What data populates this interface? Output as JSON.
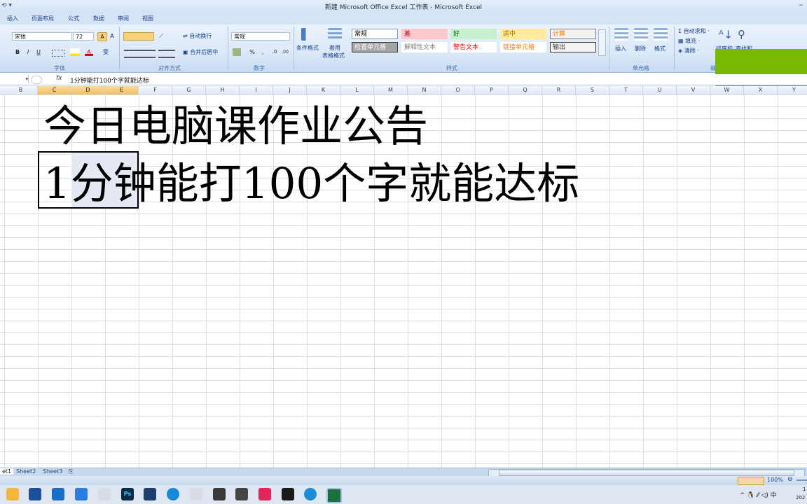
{
  "window": {
    "title": "新建 Microsoft Office Excel 工作表 - Microsoft Excel",
    "quick_access": "⟲ ▾",
    "minimize": "–"
  },
  "tabs": [
    "插入",
    "页面布局",
    "公式",
    "数据",
    "审阅",
    "视图"
  ],
  "ribbon": {
    "font": {
      "name": "宋体",
      "size": "72",
      "group_label": "字体",
      "bold": "B",
      "italic": "I",
      "underline": "U",
      "grow": "A",
      "shrink": "A",
      "font_color": "A",
      "phonetic": "雯"
    },
    "alignment": {
      "wrap_text": "自动换行",
      "merge_center": "合并后居中",
      "group_label": "对齐方式"
    },
    "number": {
      "format": "常规",
      "group_label": "数字",
      "percent": "%",
      "comma": ",",
      "inc_dec": ".0",
      "dec_dec": ".00"
    },
    "styles": {
      "conditional": "条件格式",
      "table_format_1": "套用",
      "table_format_2": "表格格式",
      "cells": [
        {
          "label": "常规",
          "bg": "#ffffff",
          "color": "#000000",
          "border": "#7f9db9"
        },
        {
          "label": "差",
          "bg": "#ffc7ce",
          "color": "#9c0006",
          "border": "#ffc7ce"
        },
        {
          "label": "好",
          "bg": "#c6efce",
          "color": "#006100",
          "border": "#c6efce"
        },
        {
          "label": "适中",
          "bg": "#ffeb9c",
          "color": "#9c6500",
          "border": "#ffeb9c"
        },
        {
          "label": "计算",
          "bg": "#f2f2f2",
          "color": "#fa7d00",
          "border": "#7f7f7f"
        },
        {
          "label": "检查单元格",
          "bg": "#a5a5a5",
          "color": "#ffffff",
          "border": "#3f3f3f"
        },
        {
          "label": "解释性文本",
          "bg": "#ffffff",
          "color": "#7f7f7f",
          "border": "#ffffff"
        },
        {
          "label": "警告文本",
          "bg": "#ffffff",
          "color": "#ff0000",
          "border": "#ffffff"
        },
        {
          "label": "链接单元格",
          "bg": "#ffffff",
          "color": "#fa7d00",
          "border": "#ffffff"
        },
        {
          "label": "输出",
          "bg": "#f2f2f2",
          "color": "#3f3f3f",
          "border": "#3f3f3f"
        }
      ],
      "group_label": "样式"
    },
    "cells_group": {
      "insert": "插入",
      "delete": "删除",
      "format": "格式",
      "group_label": "单元格"
    },
    "editing": {
      "autosum": "Σ 自动求和 ·",
      "fill": "填充 ·",
      "clear": "清除 ·",
      "sort": "排序和",
      "find": "查找和",
      "group_label": "编"
    }
  },
  "formula_bar": {
    "fx": "fx",
    "content": "1分钟能打100个字就能达标"
  },
  "columns": [
    "B",
    "C",
    "D",
    "E",
    "F",
    "G",
    "H",
    "I",
    "J",
    "K",
    "L",
    "M",
    "N",
    "O",
    "P",
    "Q",
    "R",
    "S",
    "T",
    "U",
    "V",
    "W",
    "X",
    "Y"
  ],
  "selected_columns": [
    "C",
    "D",
    "E"
  ],
  "cells": {
    "line1": "今日电脑课作业公告",
    "line2": "1分钟能打100个字就能达标"
  },
  "sheet_tabs": [
    "et1",
    "Sheet2",
    "Sheet3"
  ],
  "status": {
    "zoom": "100%"
  },
  "taskbar": {
    "tray": "^ 🐧 ⁄⁄ ◁) 中",
    "clock_1": "1",
    "clock_2": "202"
  },
  "accent": {
    "overlay_green": "#76b900",
    "selection": "#e4e9f4"
  }
}
